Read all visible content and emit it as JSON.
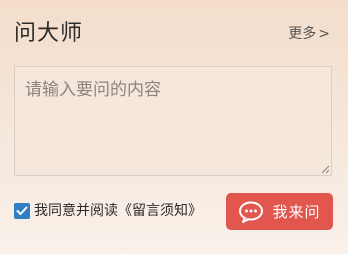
{
  "header": {
    "title": "问大师",
    "more_label": "更多",
    "more_chevron": ">"
  },
  "question": {
    "placeholder": "请输入要问的内容",
    "value": ""
  },
  "agreement": {
    "checked": true,
    "prefix": "我同意并阅读",
    "notice_link": "《留言须知》"
  },
  "ask_button": {
    "label": "我来问",
    "icon": "chat-bubble-icon"
  },
  "colors": {
    "accent": "#e1574d",
    "checkbox": "#2f7fc3"
  }
}
